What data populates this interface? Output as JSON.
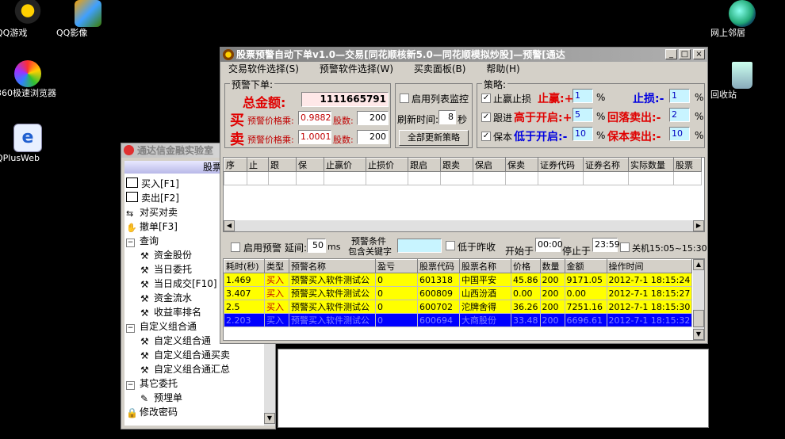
{
  "desktop": {
    "icons": [
      {
        "label": "QQ游戏"
      },
      {
        "label": "QQ影像"
      },
      {
        "label": "360极速浏览器"
      },
      {
        "label": "QPlusWeb"
      },
      {
        "label": "网上邻居"
      },
      {
        "label": "回收站"
      }
    ]
  },
  "tdx_window": {
    "title": "通达信金融实验室",
    "panel_header": "股票",
    "tree": [
      {
        "label": "买入[F1]",
        "icon": "buy-icon"
      },
      {
        "label": "卖出[F2]",
        "icon": "sell-icon"
      },
      {
        "label": "对买对卖",
        "icon": "swap-icon"
      },
      {
        "label": "撤单[F3]",
        "icon": "hand-icon"
      },
      {
        "label": "查询",
        "icon": "collapse-icon"
      },
      {
        "label": "资金股份",
        "icon": "tool-icon"
      },
      {
        "label": "当日委托",
        "icon": "tool-icon"
      },
      {
        "label": "当日成交[F10]",
        "icon": "tool-icon"
      },
      {
        "label": "资金流水",
        "icon": "tool-icon"
      },
      {
        "label": "收益率排名",
        "icon": "tool-icon"
      },
      {
        "label": "自定义组合通",
        "icon": "collapse-icon"
      },
      {
        "label": "自定义组合通",
        "icon": "tool-icon"
      },
      {
        "label": "自定义组合通买卖",
        "icon": "tool-icon"
      },
      {
        "label": "自定义组合通汇总",
        "icon": "tool-icon"
      },
      {
        "label": "其它委托",
        "icon": "collapse-icon"
      },
      {
        "label": "预埋单",
        "icon": "note-icon"
      },
      {
        "label": "修改密码",
        "icon": "lock-icon"
      }
    ]
  },
  "main_window": {
    "title": "股票预警自动下单v1.0—交易[同花顺核新5.0—同花顺模拟炒股]—预警[通达",
    "controls": {
      "minimize": "_",
      "maximize": "□",
      "close": "×"
    },
    "menu": [
      "交易软件选择(S)",
      "预警软件选择(W)",
      "买卖面板(B)",
      "帮助(H)"
    ],
    "order": {
      "legend": "预警下单:",
      "total_label": "总金额:",
      "total_value": "1111665791",
      "buy_char": "买",
      "sell_char": "卖",
      "price_mult_label": "预警价格乘:",
      "buy_mult": "0.9882",
      "sell_mult": "1.0001",
      "shares_label": "股数:",
      "buy_shares": "200",
      "sell_shares": "200"
    },
    "monitor": {
      "enable_list_label": "启用列表监控",
      "refresh_label": "刷新时间:",
      "refresh_value": "8",
      "refresh_unit": "秒",
      "update_all_button": "全部更新策略"
    },
    "strategy": {
      "legend": "策略:",
      "take_profit_check": "止赢止损",
      "take_profit_label": "止赢:+",
      "take_profit_value": "1",
      "stop_loss_label": "止损:-",
      "stop_loss_value": "1",
      "follow_check": "跟进",
      "follow_label": "高于开启:+",
      "follow_value": "5",
      "pullback_label": "回落卖出:-",
      "pullback_value": "2",
      "protect_check": "保本",
      "protect_label": "低于开启:-",
      "protect_value": "10",
      "protect_sell_label": "保本卖出:-",
      "protect_sell_value": "10",
      "pct": "%"
    },
    "strategy_table": {
      "headers": [
        "序",
        "止",
        "跟",
        "保",
        "止赢价",
        "止损价",
        "跟启",
        "跟卖",
        "保启",
        "保卖",
        "证券代码",
        "证券名称",
        "实际数量",
        "股票"
      ]
    },
    "alert_bar": {
      "enable_alert": "启用预警",
      "delay_label": "延间:",
      "delay_value": "50",
      "delay_unit": "ms",
      "keyword_label_1": "预警条件",
      "keyword_label_2": "包含关键字",
      "keyword_value": "",
      "below_yesterday": "低于昨收",
      "start_label": "开始于",
      "start_value": "00:00",
      "stop_label": "停止于",
      "stop_value": "23:59",
      "shutdown_label": "关机15:05~15:30"
    },
    "log_table": {
      "headers": [
        "耗时(秒)",
        "类型",
        "预警名称",
        "盈亏",
        "股票代码",
        "股票名称",
        "价格",
        "数量",
        "金额",
        "操作时间"
      ],
      "rows": [
        [
          "1.469",
          "买入",
          "预警买入软件测试公",
          "0",
          "601318",
          "中国平安",
          "45.86",
          "200",
          "9171.05",
          "2012-7-1 18:15:24"
        ],
        [
          "3.407",
          "买入",
          "预警买入软件测试公",
          "0",
          "600809",
          "山西汾酒",
          "0.00",
          "200",
          "0.00",
          "2012-7-1 18:15:27"
        ],
        [
          "2.5",
          "买入",
          "预警买入软件测试公",
          "0",
          "600702",
          "沱牌舍得",
          "36.26",
          "200",
          "7251.16",
          "2012-7-1 18:15:30"
        ],
        [
          "2.203",
          "买入",
          "预警买入软件测试公",
          "0",
          "600694",
          "大商股份",
          "33.48",
          "200",
          "6696.61",
          "2012-7-1 18:15:32"
        ]
      ]
    }
  }
}
